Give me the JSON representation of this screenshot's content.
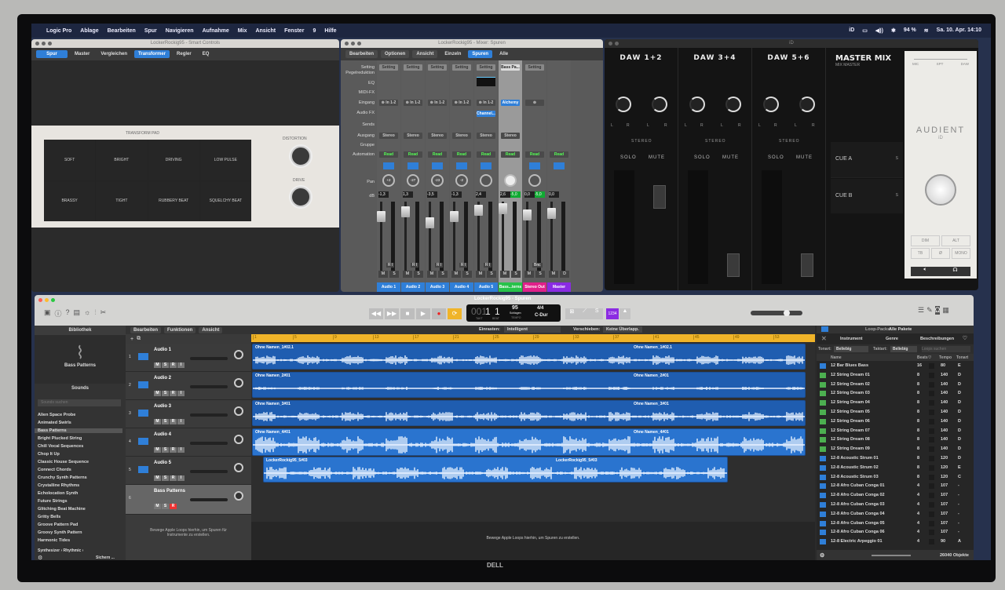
{
  "menubar": {
    "items": [
      "Logic Pro",
      "Ablage",
      "Bearbeiten",
      "Spur",
      "Navigieren",
      "Aufnahme",
      "Mix",
      "Ansicht",
      "Fenster",
      "9",
      "Hilfe"
    ],
    "status": [
      "iD",
      "▭",
      "◀))",
      "✱",
      "94 %",
      "≋",
      "Sa. 10. Apr. 14:10"
    ]
  },
  "smart_controls": {
    "title": "LockerRockig95 - Smart Controls",
    "tabs": [
      "Spur",
      "Master",
      "Vergleichen",
      "Transformer",
      "Regler",
      "EQ"
    ],
    "pad_title": "TRANSFORM PAD",
    "pads": [
      "SOFT",
      "BRIGHT",
      "DRIVING",
      "LOW PULSE",
      "BRASSY",
      "TIGHT",
      "RUBBERY BEAT",
      "SQUELCHY BEAT"
    ],
    "knobs": [
      "DISTORTION",
      "DRIVE"
    ]
  },
  "mixer": {
    "title": "LockerRockig95 - Mixer: Spuren",
    "menus": [
      "Bearbeiten",
      "Optionen",
      "Ansicht"
    ],
    "views": [
      "Einzeln",
      "Spuren",
      "Alle"
    ],
    "row_labels": [
      "Setting",
      "Pegelreduktion",
      "EQ",
      "MIDI-FX",
      "Eingang",
      "Audio FX",
      "Sends",
      "Ausgang",
      "Gruppe",
      "Automation",
      "Pan",
      "dB"
    ],
    "strips": [
      {
        "name": "Audio 1",
        "setting": "Setting",
        "input": "⊚ In 1-2",
        "fx": "",
        "output": "Stereo",
        "auto": "Read",
        "pan": "+2",
        "db": "-1,3",
        "db2": "",
        "color": "#2f7fd8",
        "btn": "R I"
      },
      {
        "name": "Audio 2",
        "setting": "Setting",
        "input": "⊚ In 1-2",
        "fx": "",
        "output": "Stereo",
        "auto": "Read",
        "pan": "-27",
        "db": "1,3",
        "db2": "",
        "color": "#2f7fd8",
        "btn": "R I"
      },
      {
        "name": "Audio 3",
        "setting": "Setting",
        "input": "⊚ In 1-2",
        "fx": "",
        "output": "Stereo",
        "auto": "Read",
        "pan": "-23",
        "db": "-3,5",
        "db2": "",
        "color": "#2f7fd8",
        "btn": "R I"
      },
      {
        "name": "Audio 4",
        "setting": "Setting",
        "input": "⊚ In 1-2",
        "fx": "",
        "output": "Stereo",
        "auto": "Read",
        "pan": "-2",
        "db": "-1,3",
        "db2": "",
        "color": "#2f7fd8",
        "btn": "R I"
      },
      {
        "name": "Audio 5",
        "setting": "Setting",
        "input": "⊚ In 1-2",
        "fx": "Channel...",
        "output": "Stereo",
        "auto": "Read",
        "pan": "",
        "db": "2,4",
        "db2": "",
        "color": "#2f7fd8",
        "btn": "R I"
      },
      {
        "name": "Bass...terns",
        "setting": "Bass Pa...",
        "input": "Alchemy",
        "fx": "",
        "output": "Stereo",
        "auto": "Read",
        "pan": "",
        "db": "2,6",
        "db2": "-5,0",
        "color": "#27c24a",
        "btn": ""
      },
      {
        "name": "Stereo Out",
        "setting": "Setting",
        "input": "⊚",
        "fx": "",
        "output": "",
        "auto": "Read",
        "pan": "",
        "db": "0,0",
        "db2": "-5,0",
        "color": "#e0208a",
        "btn": "Bnc"
      },
      {
        "name": "Master",
        "setting": "",
        "input": "",
        "fx": "",
        "output": "",
        "auto": "Read",
        "pan": "",
        "db": "0,0",
        "db2": "",
        "color": "#8a2be2",
        "btn": ""
      }
    ],
    "ms": [
      "M",
      "S"
    ],
    "md": [
      "M",
      "D"
    ]
  },
  "id_app": {
    "title": "iD",
    "channels": [
      "DAW 1+2",
      "DAW 3+4",
      "DAW 5+6"
    ],
    "stereo": "STEREO",
    "solo": "SOLO",
    "mute": "MUTE",
    "lr": [
      "L",
      "R"
    ],
    "master": "MASTER MIX",
    "master_sub": "MIX MASTER",
    "cues": [
      "CUE A",
      "CUE B"
    ],
    "cue_s": "S",
    "sources": [
      "MIC",
      "SPT",
      "DAW"
    ],
    "brand": "AUDIENT",
    "brand_sub": "iD",
    "buttons": [
      "DIM",
      "ALT",
      "TB",
      "Ø",
      "MONO"
    ]
  },
  "main": {
    "title": "LockerRockig95 - Spuren",
    "transport": {
      "bar": "001",
      "beat": "1",
      "bar_num": "1",
      "bar_label": "TAKT",
      "beat_label": "BEAT",
      "tempo": "95",
      "tempo_sub": "Schlagen",
      "tempo_label": "TEMPO",
      "sig": "4/4",
      "key": "C-Dur",
      "count_in": "1234"
    },
    "menus": [
      "Bearbeiten",
      "Funktionen",
      "Ansicht"
    ],
    "snap_label": "Einrasten:",
    "snap": "Intelligent",
    "drag_label": "Verschieben:",
    "drag": "Keine Überlapp.",
    "ruler": [
      "1",
      "5",
      "9",
      "13",
      "17",
      "21",
      "25",
      "29",
      "33",
      "37",
      "41",
      "45",
      "49",
      "53"
    ],
    "tracks": [
      {
        "num": "1",
        "name": "Audio 1",
        "region": "Ohne Namen_1#02.1"
      },
      {
        "num": "2",
        "name": "Audio 2",
        "region": "Ohne Namen_2#01"
      },
      {
        "num": "3",
        "name": "Audio 3",
        "region": "Ohne Namen_3#01"
      },
      {
        "num": "4",
        "name": "Audio 4",
        "region": "Ohne Namen_4#01"
      },
      {
        "num": "5",
        "name": "Audio 5",
        "region": "LockerRockig95_5#03"
      },
      {
        "num": "6",
        "name": "Bass Patterns",
        "region": ""
      }
    ],
    "track_btns": [
      "M",
      "S",
      "R",
      "I"
    ],
    "drop_hint_tracks": "Bewege Apple Loops hierhin, um Spuren für Instrumente zu erstellen.",
    "drop_hint_arrange": "Bewege Apple Loops hierhin, um Spuren zu erstellen."
  },
  "library": {
    "title": "Bibliothek",
    "patch": "Bass Patterns",
    "sounds": "Sounds",
    "search_placeholder": "Sounds suchen",
    "items": [
      "Alien Space Probe",
      "Animated Swirls",
      "Bass Patterns",
      "Bright Plucked String",
      "Chill Vocal Sequences",
      "Chop It Up",
      "Classic House Sequence",
      "Connect Chords",
      "Crunchy Synth Patterns",
      "Crystalline Rhythms",
      "Echolocation Synth",
      "Future Strings",
      "Glitching Beat Machine",
      "Gritty Bells",
      "Groove Pattern Pad",
      "Groovy Synth Pattern",
      "Harmonic Tides"
    ],
    "selected": 2,
    "path": "Synthesizer › Rhythmic ›",
    "save": "Sichern ..."
  },
  "loops": {
    "packs_label": "Loop-Packs:",
    "packs": "Alle Pakete",
    "tabs": [
      "Instrument",
      "Genre",
      "Beschreibungen"
    ],
    "key_label": "Tonart:",
    "key": "Beliebig",
    "sig_label": "Taktart:",
    "sig": "Beliebig",
    "search_placeholder": "Loops suchen",
    "columns": [
      "Name",
      "Beats",
      "♡",
      "Tempo",
      "Tonart"
    ],
    "rows": [
      [
        "12 Bar Blues Bass",
        "16",
        "80",
        "E",
        "audio"
      ],
      [
        "12 String Dream 01",
        "8",
        "140",
        "D",
        "midi"
      ],
      [
        "12 String Dream 02",
        "8",
        "140",
        "D",
        "midi"
      ],
      [
        "12 String Dream 03",
        "8",
        "140",
        "D",
        "midi"
      ],
      [
        "12 String Dream 04",
        "8",
        "140",
        "D",
        "midi"
      ],
      [
        "12 String Dream 05",
        "8",
        "140",
        "D",
        "midi"
      ],
      [
        "12 String Dream 06",
        "8",
        "140",
        "D",
        "midi"
      ],
      [
        "12 String Dream 07",
        "8",
        "140",
        "D",
        "midi"
      ],
      [
        "12 String Dream 08",
        "8",
        "140",
        "D",
        "midi"
      ],
      [
        "12 String Dream 09",
        "8",
        "140",
        "D",
        "midi"
      ],
      [
        "12-8 Acoustic Strum 01",
        "8",
        "120",
        "D",
        "audio"
      ],
      [
        "12-8 Acoustic Strum 02",
        "8",
        "120",
        "E",
        "audio"
      ],
      [
        "12-8 Acoustic Strum 03",
        "8",
        "120",
        "C",
        "audio"
      ],
      [
        "12-8 Afro Cuban Conga 01",
        "4",
        "107",
        "-",
        "audio"
      ],
      [
        "12-8 Afro Cuban Conga 02",
        "4",
        "107",
        "-",
        "audio"
      ],
      [
        "12-8 Afro Cuban Conga 03",
        "4",
        "107",
        "-",
        "audio"
      ],
      [
        "12-8 Afro Cuban Conga 04",
        "4",
        "107",
        "-",
        "audio"
      ],
      [
        "12-8 Afro Cuban Conga 05",
        "4",
        "107",
        "-",
        "audio"
      ],
      [
        "12-8 Afro Cuban Conga 06",
        "4",
        "107",
        "-",
        "audio"
      ],
      [
        "12-8 Electric Arpeggio 01",
        "4",
        "90",
        "A",
        "audio"
      ]
    ],
    "count": "26040 Objekte"
  },
  "bezel_logo": "DELL"
}
